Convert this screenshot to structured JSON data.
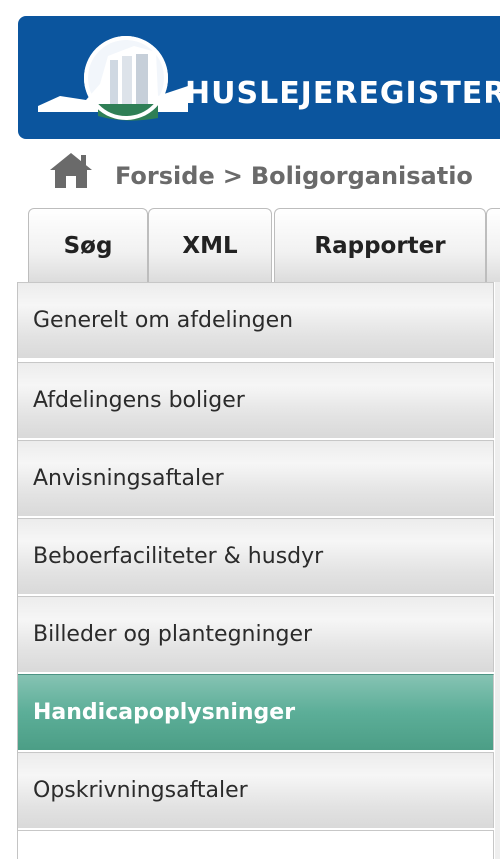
{
  "header": {
    "site_title": "HUSLEJEREGISTER"
  },
  "breadcrumb": {
    "icon": "home-icon",
    "items": [
      "Forside",
      "Boligorganisatio"
    ],
    "separator": ">"
  },
  "tabs": [
    {
      "label": "Søg"
    },
    {
      "label": "XML"
    },
    {
      "label": "Rapporter"
    }
  ],
  "menu": {
    "active_color": "#5cae98",
    "items": [
      {
        "label": "Generelt om afdelingen"
      },
      {
        "label": "Afdelingens boliger"
      },
      {
        "label": "Anvisningsaftaler"
      },
      {
        "label": "Beboerfaciliteter & husdyr"
      },
      {
        "label": "Billeder og plantegninger"
      },
      {
        "label": "Handicapoplysninger"
      },
      {
        "label": "Opskrivningsaftaler"
      }
    ]
  }
}
